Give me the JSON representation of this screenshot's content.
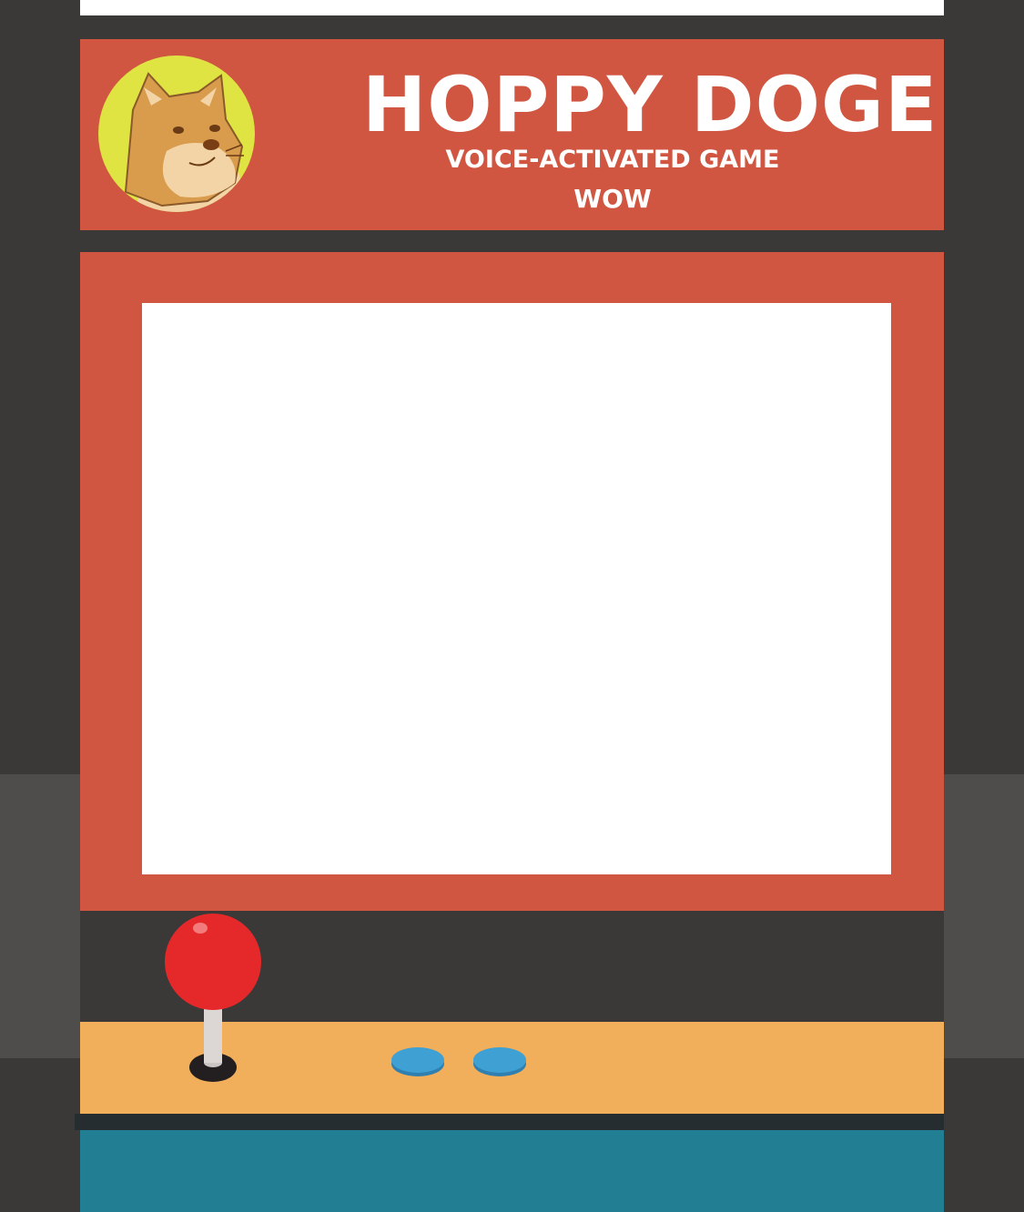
{
  "marquee": {
    "title": "HOPPY DOGE",
    "subtitle": "VOICE-ACTIVATED GAME",
    "tagline": "WOW"
  },
  "colors": {
    "cabinet_red": "#d05641",
    "cabinet_dark": "#3a3938",
    "control_panel": "#f1ae5b",
    "lower_cabinet": "#227e92",
    "joystick_ball": "#e5292a",
    "button_blue": "#3fa0d3",
    "logo_background": "#dfe443"
  },
  "icons": {
    "logo": "doge-icon",
    "joystick": "joystick-icon",
    "buttons": "arcade-button-icon"
  }
}
